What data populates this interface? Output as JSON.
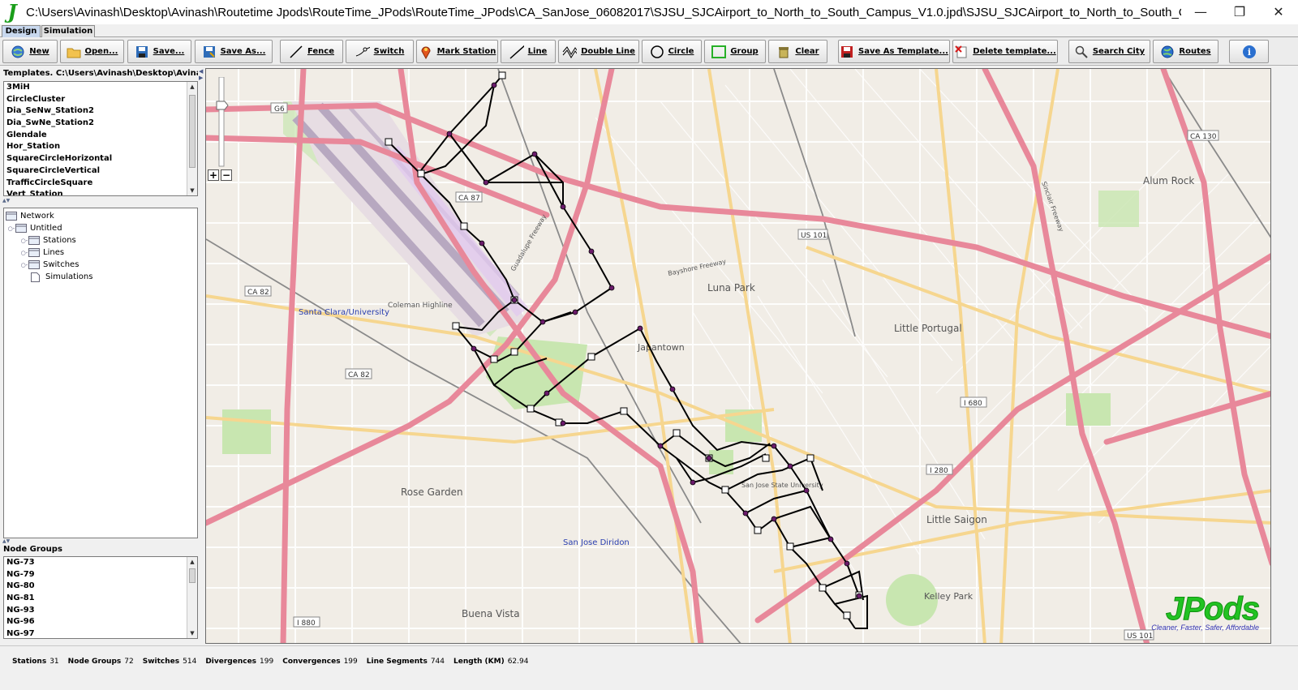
{
  "window": {
    "logo": "J",
    "title": "C:\\Users\\Avinash\\Desktop\\Avinash\\Routetime Jpods\\RouteTime_JPods\\RouteTime_JPods\\CA_SanJose_06082017\\SJSU_SJCAirport_to_North_to_South_Campus_V1.0.jpd\\SJSU_SJCAirport_to_North_to_South_Cam...",
    "minimize": "—",
    "restore": "❐",
    "close": "✕"
  },
  "tabs": [
    {
      "label": "Design",
      "active": true
    },
    {
      "label": "Simulation",
      "active": false
    }
  ],
  "toolbar": {
    "new": "New",
    "open": "Open...",
    "save": "Save...",
    "save_as": "Save As...",
    "fence": "Fence",
    "switch": "Switch",
    "mark_station": "Mark Station",
    "line": "Line",
    "double_line": "Double Line",
    "circle": "Circle",
    "group": "Group",
    "clear": "Clear",
    "save_as_template": "Save As Template...",
    "delete_template": "Delete template...",
    "search_city": "Search City",
    "routes": "Routes",
    "info": "i"
  },
  "templates": {
    "header": "Templates. C:\\Users\\Avinash\\Desktop\\Avinash\\R...",
    "items": [
      "3MiH",
      "CircleCluster",
      "Dia_SeNw_Station2",
      "Dia_SwNe_Station2",
      "Glendale",
      "Hor_Station",
      "SquareCircleHorizontal",
      "SquareCircleVertical",
      "TrafficCircleSquare",
      "Vert_Station"
    ]
  },
  "network_tree": {
    "root": "Network",
    "project": "Untitled",
    "children": [
      "Stations",
      "Lines",
      "Switches",
      "Simulations"
    ]
  },
  "node_groups": {
    "header": "Node Groups",
    "items": [
      "NG-73",
      "NG-79",
      "NG-80",
      "NG-81",
      "NG-93",
      "NG-96",
      "NG-97"
    ]
  },
  "map": {
    "labels": {
      "luna_park": "Luna Park",
      "little_portugal": "Little Portugal",
      "alum_rock": "Alum Rock",
      "japantown": "Japantown",
      "rose_garden": "Rose Garden",
      "little_saigon": "Little Saigon",
      "kelley_park": "Kelley Park",
      "buena_vista": "Buena Vista",
      "santa_clara_university": "Santa Clara/University",
      "san_jose_diridon": "San Jose Diridon",
      "sjsu": "San Jose State University",
      "coleman_highline": "Coleman Highline",
      "bayshore_freeway": "Bayshore Freeway",
      "guadalupe_freeway": "Guadalupe Freeway",
      "sinclair_freeway": "Sinclair Freeway",
      "ca87": "CA 87",
      "ca82": "CA 82",
      "us101": "US 101",
      "i680": "I 680",
      "i280": "I 280",
      "i880": "I 880",
      "ca130": "CA 130",
      "g6": "G6"
    },
    "brand": {
      "word": "JPods",
      "tagline": "Cleaner, Faster, Safer, Affordable"
    }
  },
  "status": [
    {
      "key": "Stations",
      "value": "31"
    },
    {
      "key": "Node Groups",
      "value": "72"
    },
    {
      "key": "Switches",
      "value": "514"
    },
    {
      "key": "Divergences",
      "value": "199"
    },
    {
      "key": "Convergences",
      "value": "199"
    },
    {
      "key": "Line Segments",
      "value": "744"
    },
    {
      "key": "Length (KM)",
      "value": "62.94"
    }
  ],
  "colors": {
    "map_bg": "#f1ede6",
    "freeway": "#e8889a",
    "major_road": "#f6d68f",
    "park": "#c8e6b0",
    "route": "#000000",
    "jpods_green": "#22c322"
  }
}
